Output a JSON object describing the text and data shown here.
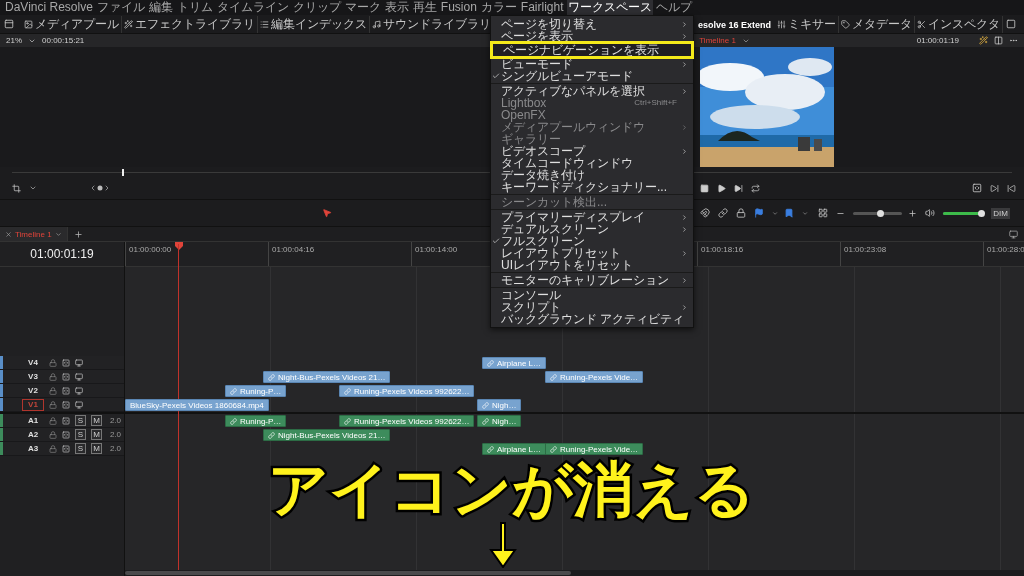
{
  "menubar": [
    {
      "label": "DaVinci Resolve",
      "selected": false
    },
    {
      "label": "ファイル",
      "selected": false
    },
    {
      "label": "編集",
      "selected": false
    },
    {
      "label": "トリム",
      "selected": false
    },
    {
      "label": "タイムライン",
      "selected": false
    },
    {
      "label": "クリップ",
      "selected": false
    },
    {
      "label": "マーク",
      "selected": false
    },
    {
      "label": "表示",
      "selected": false
    },
    {
      "label": "再生",
      "selected": false
    },
    {
      "label": "Fusion",
      "selected": false
    },
    {
      "label": "カラー",
      "selected": false
    },
    {
      "label": "Fairlight",
      "selected": false
    },
    {
      "label": "ワークスペース",
      "selected": true
    },
    {
      "label": "ヘルプ",
      "selected": false
    }
  ],
  "toolbar": {
    "left": [
      "メディアプール",
      "エフェクトライブラリ",
      "編集インデックス",
      "サウンドライブラリ"
    ],
    "title": "esolve 16 Extend",
    "right": [
      "ミキサー",
      "メタデータ",
      "インスペクタ"
    ]
  },
  "viewer_header": {
    "zoom": "21%",
    "timecode": "00:00:15:21",
    "timeline": "Timeline 1",
    "current_timecode": "01:00:01:19"
  },
  "edit_toolbar": {
    "zoom_slider": {
      "level": 0.55
    },
    "volume": {
      "level": 0.95
    },
    "dim": "DIM"
  },
  "timeline_tabs": [
    {
      "label": "Timeline 1",
      "selected": true
    }
  ],
  "timeline": {
    "timecode": "01:00:01:19",
    "ruler": [
      "01:00:00:00",
      "01:00:04:16",
      "01:00:14:00",
      "01:00:18:16",
      "01:00:23:08",
      "01:00:28:0"
    ],
    "tracks": [
      {
        "name": "V4",
        "kind": "video",
        "target": false,
        "clips": [
          {
            "label": "Airplane L…",
            "linked": true
          }
        ]
      },
      {
        "name": "V3",
        "kind": "video",
        "target": false,
        "clips": [
          {
            "label": "Night-Bus-Pexels Videos 21…",
            "linked": true
          },
          {
            "label": "Runing-Pexels Vide…",
            "linked": true
          }
        ]
      },
      {
        "name": "V2",
        "kind": "video",
        "target": false,
        "clips": [
          {
            "label": "Runing-P…",
            "linked": true
          },
          {
            "label": "Runing-Pexels Videos 992622…",
            "linked": true
          }
        ]
      },
      {
        "name": "V1",
        "kind": "video",
        "target": true,
        "clips": [
          {
            "label": "BlueSky-Pexels Videos 1860684.mp4",
            "linked": false
          },
          {
            "label": "Nigh…",
            "linked": true
          }
        ]
      },
      {
        "name": "A1",
        "kind": "audio",
        "target": false,
        "buttons": [
          "S",
          "M"
        ],
        "channels": "2.0",
        "clips": [
          {
            "label": "Runing-P…",
            "linked": true
          },
          {
            "label": "Runing-Pexels Videos 992622…",
            "linked": true
          },
          {
            "label": "Nigh…",
            "linked": true
          }
        ]
      },
      {
        "name": "A2",
        "kind": "audio",
        "target": false,
        "buttons": [
          "S",
          "M"
        ],
        "channels": "2.0",
        "clips": [
          {
            "label": "Night-Bus-Pexels Videos 21…",
            "linked": true
          }
        ]
      },
      {
        "name": "A3",
        "kind": "audio",
        "target": false,
        "buttons": [
          "S",
          "M"
        ],
        "channels": "2.0",
        "clips": [
          {
            "label": "Airplane L…",
            "linked": true
          },
          {
            "label": "Runing-Pexels Vide…",
            "linked": true
          }
        ]
      }
    ]
  },
  "workspace_menu": {
    "items": [
      {
        "kind": "item",
        "label": "ページを切り替え",
        "checked": false,
        "disabled": false,
        "submenu": true,
        "highlighted": false
      },
      {
        "kind": "item",
        "label": "ページを表示",
        "checked": false,
        "disabled": false,
        "submenu": true,
        "highlighted": false
      },
      {
        "kind": "item",
        "label": "ページナビゲーションを表示",
        "checked": false,
        "disabled": false,
        "submenu": false,
        "highlighted": true
      },
      {
        "kind": "item",
        "label": "ビューモード",
        "checked": false,
        "disabled": false,
        "submenu": true,
        "highlighted": false
      },
      {
        "kind": "item",
        "label": "シングルビューアモード",
        "checked": true,
        "disabled": false,
        "submenu": false,
        "highlighted": false
      },
      {
        "kind": "separator"
      },
      {
        "kind": "item",
        "label": "アクティブなパネルを選択",
        "checked": false,
        "disabled": false,
        "submenu": true,
        "highlighted": false
      },
      {
        "kind": "item",
        "label": "Lightbox",
        "shortcut": "Ctrl+Shift+F",
        "checked": false,
        "disabled": true,
        "submenu": false,
        "highlighted": false
      },
      {
        "kind": "item",
        "label": "OpenFX",
        "checked": false,
        "disabled": true,
        "submenu": false,
        "highlighted": false
      },
      {
        "kind": "item",
        "label": "メディアプールウィンドウ",
        "checked": false,
        "disabled": true,
        "submenu": true,
        "highlighted": false
      },
      {
        "kind": "item",
        "label": "ギャラリー",
        "checked": false,
        "disabled": true,
        "submenu": false,
        "highlighted": false
      },
      {
        "kind": "item",
        "label": "ビデオスコープ",
        "checked": false,
        "disabled": false,
        "submenu": true,
        "highlighted": false
      },
      {
        "kind": "item",
        "label": "タイムコードウィンドウ",
        "checked": false,
        "disabled": false,
        "submenu": false,
        "highlighted": false
      },
      {
        "kind": "item",
        "label": "データ焼き付け",
        "checked": false,
        "disabled": false,
        "submenu": false,
        "highlighted": false
      },
      {
        "kind": "item",
        "label": "キーワードディクショナリー...",
        "checked": false,
        "disabled": false,
        "submenu": false,
        "highlighted": false
      },
      {
        "kind": "separator"
      },
      {
        "kind": "item",
        "label": "シーンカット検出...",
        "checked": false,
        "disabled": true,
        "submenu": false,
        "highlighted": false
      },
      {
        "kind": "separator"
      },
      {
        "kind": "item",
        "label": "プライマリーディスプレイ",
        "checked": false,
        "disabled": false,
        "submenu": true,
        "highlighted": false
      },
      {
        "kind": "item",
        "label": "デュアルスクリーン",
        "checked": false,
        "disabled": false,
        "submenu": true,
        "highlighted": false
      },
      {
        "kind": "item",
        "label": "フルスクリーン",
        "checked": true,
        "disabled": false,
        "submenu": false,
        "highlighted": false
      },
      {
        "kind": "item",
        "label": "レイアウトプリセット",
        "checked": false,
        "disabled": false,
        "submenu": true,
        "highlighted": false
      },
      {
        "kind": "item",
        "label": "UIレイアウトをリセット",
        "checked": false,
        "disabled": false,
        "submenu": false,
        "highlighted": false
      },
      {
        "kind": "separator"
      },
      {
        "kind": "item",
        "label": "モニターのキャリブレーション",
        "checked": false,
        "disabled": false,
        "submenu": true,
        "highlighted": false
      },
      {
        "kind": "separator"
      },
      {
        "kind": "item",
        "label": "コンソール",
        "checked": false,
        "disabled": false,
        "submenu": false,
        "highlighted": false
      },
      {
        "kind": "item",
        "label": "スクリプト",
        "checked": false,
        "disabled": false,
        "submenu": true,
        "highlighted": false
      },
      {
        "kind": "item",
        "label": "バックグラウンド アクティビティ",
        "checked": false,
        "disabled": false,
        "submenu": false,
        "highlighted": false
      }
    ]
  },
  "caption": "アイコンが消える"
}
